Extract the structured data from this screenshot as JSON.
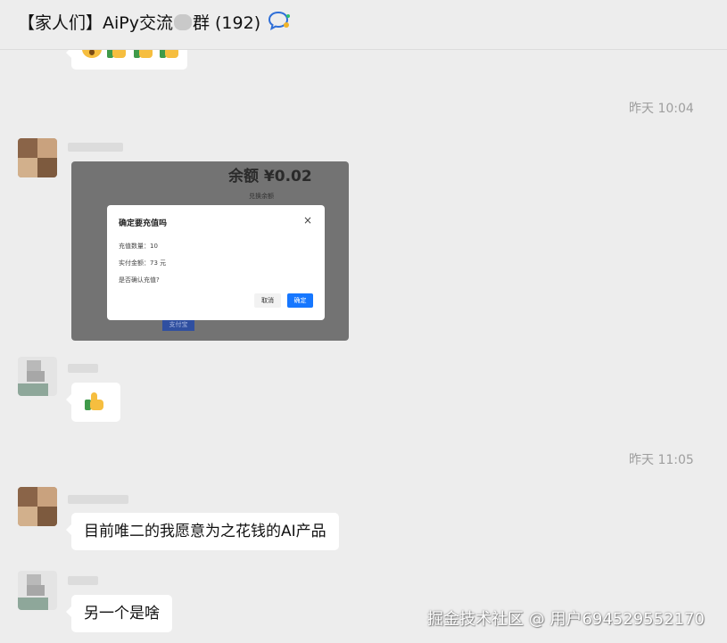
{
  "header": {
    "title": "【家人们】AiPy交流",
    "title_suffix": "群 (192)",
    "chat_icon": "chat-bubble-ai-icon"
  },
  "messages": {
    "emoji_row": "😲👍👍👍",
    "timestamp_1": "昨天 10:04",
    "screenshot": {
      "balance": "余额 ¥0.02",
      "subtitle": "兑换余额",
      "background_button": "支付宝",
      "dialog": {
        "title": "确定要充值吗",
        "close": "×",
        "row_1": "充值数量：10",
        "row_2": "实付金额：73 元",
        "row_3": "是否确认充值?",
        "cancel": "取消",
        "confirm": "确定"
      }
    },
    "thumbs_up": "👍",
    "timestamp_2": "昨天 11:05",
    "text_1": "目前唯二的我愿意为之花钱的AI产品",
    "text_2": "另一个是啥"
  },
  "watermark": "掘金技术社区 @ 用户694529552170",
  "colors": {
    "background": "#ededed",
    "bubble": "#ffffff",
    "accent": "#1677ff",
    "timestamp": "#9e9e9e"
  }
}
